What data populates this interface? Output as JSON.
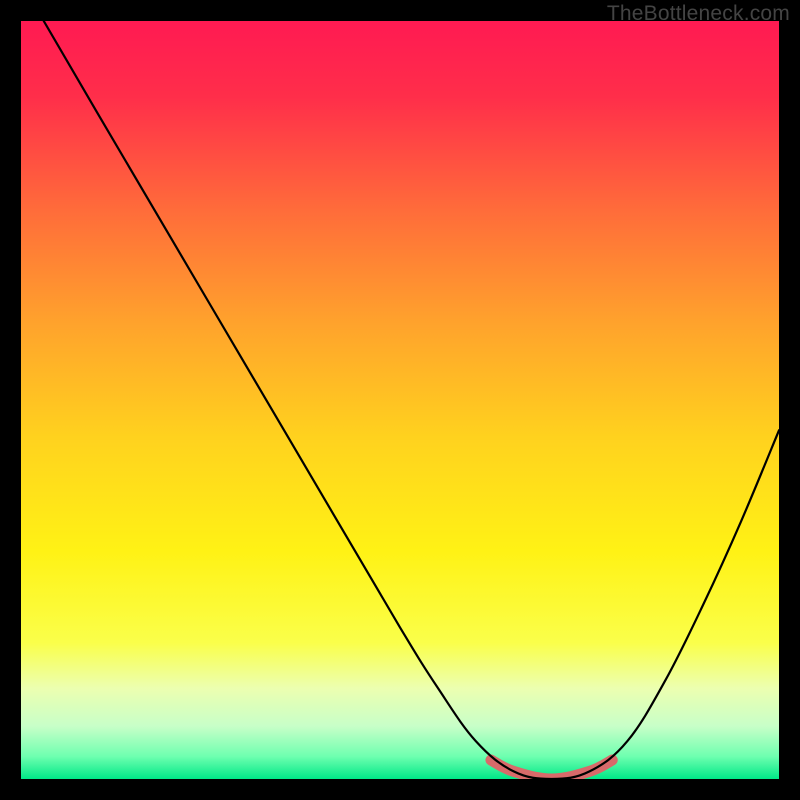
{
  "watermark": "TheBottleneck.com",
  "chart_data": {
    "type": "line",
    "title": "",
    "xlabel": "",
    "ylabel": "",
    "xlim": [
      0,
      100
    ],
    "ylim": [
      0,
      100
    ],
    "series": [
      {
        "name": "bottleneck-curve",
        "x": [
          3,
          10,
          20,
          30,
          40,
          50,
          55,
          60,
          65,
          70,
          75,
          80,
          85,
          90,
          95,
          100
        ],
        "values": [
          100,
          88,
          71,
          54,
          37,
          20,
          12,
          5,
          1,
          0,
          1,
          5,
          13,
          23,
          34,
          46
        ]
      }
    ],
    "highlight_segment": {
      "x": [
        62,
        65,
        70,
        75,
        78
      ],
      "values": [
        2.5,
        1,
        0,
        1,
        2.5
      ]
    },
    "gradient_stops": [
      {
        "offset": 0.0,
        "color": "#ff1a52"
      },
      {
        "offset": 0.1,
        "color": "#ff2e4a"
      },
      {
        "offset": 0.25,
        "color": "#ff6c3a"
      },
      {
        "offset": 0.4,
        "color": "#ffa32c"
      },
      {
        "offset": 0.55,
        "color": "#ffd21e"
      },
      {
        "offset": 0.7,
        "color": "#fff215"
      },
      {
        "offset": 0.82,
        "color": "#faff4a"
      },
      {
        "offset": 0.88,
        "color": "#ecffb0"
      },
      {
        "offset": 0.93,
        "color": "#c8ffc8"
      },
      {
        "offset": 0.97,
        "color": "#6fffb0"
      },
      {
        "offset": 1.0,
        "color": "#00e887"
      }
    ],
    "highlight_color": "#d86a6a",
    "curve_color": "#000000"
  }
}
